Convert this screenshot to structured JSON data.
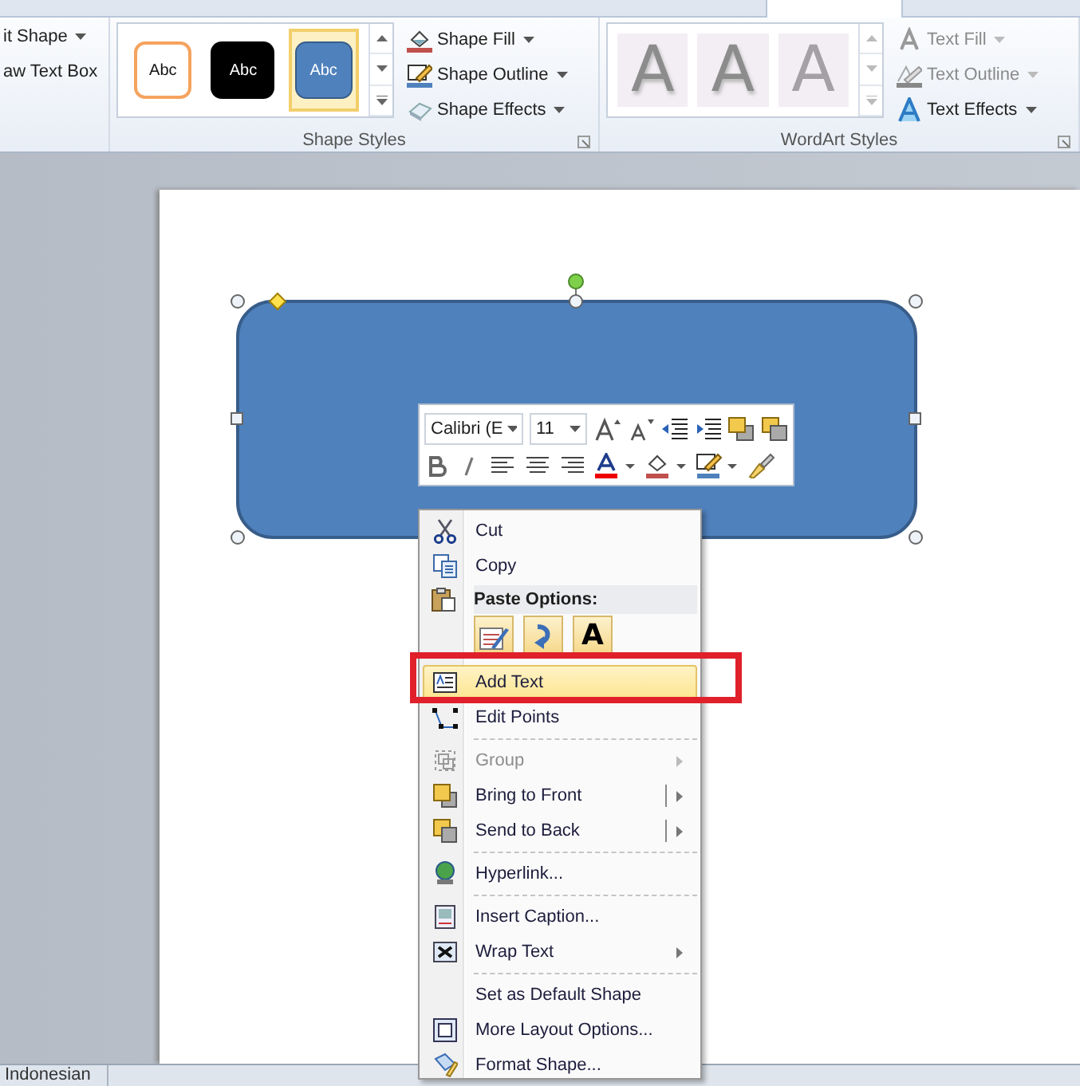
{
  "ribbon": {
    "partial_group": {
      "buttons": [
        {
          "label": "it Shape",
          "dropdown": true
        },
        {
          "label": "aw Text Box"
        }
      ]
    },
    "shape_styles": {
      "swatches": [
        {
          "label": "Abc",
          "kind": "outline",
          "selected": false
        },
        {
          "label": "Abc",
          "kind": "dark",
          "selected": false
        },
        {
          "label": "Abc",
          "kind": "blue",
          "selected": true
        }
      ],
      "buttons": [
        {
          "label": "Shape Fill",
          "disabled": false
        },
        {
          "label": "Shape Outline",
          "disabled": false
        },
        {
          "label": "Shape Effects",
          "disabled": false
        }
      ],
      "title": "Shape Styles"
    },
    "wordart_styles": {
      "swatches": [
        {
          "label": "A",
          "kind": "shadow"
        },
        {
          "label": "A",
          "kind": "shadow"
        },
        {
          "label": "A",
          "kind": "faint"
        }
      ],
      "buttons": [
        {
          "label": "Text Fill",
          "disabled": true
        },
        {
          "label": "Text Outline",
          "disabled": true
        },
        {
          "label": "Text Effects",
          "disabled": false
        }
      ],
      "title": "WordArt Styles"
    }
  },
  "mini_toolbar": {
    "font": "Calibri (E",
    "size": "11"
  },
  "context_menu": {
    "items": [
      {
        "kind": "item",
        "label": "Cut",
        "disabled": false,
        "submenu": false,
        "split": false,
        "selected": false,
        "annotated": false
      },
      {
        "kind": "item",
        "label": "Copy",
        "disabled": false,
        "submenu": false,
        "split": false,
        "selected": false,
        "annotated": false
      },
      {
        "kind": "header",
        "label": "Paste Options:"
      },
      {
        "kind": "paste",
        "buttons": [
          {
            "kind": "icon"
          },
          {
            "kind": "icon"
          },
          {
            "kind": "text",
            "label": "A"
          }
        ]
      },
      {
        "kind": "item",
        "label": "Add Text",
        "disabled": false,
        "submenu": false,
        "split": false,
        "selected": true,
        "annotated": true
      },
      {
        "kind": "item",
        "label": "Edit Points",
        "disabled": false,
        "submenu": false,
        "split": false,
        "selected": false,
        "annotated": false
      },
      {
        "kind": "separator"
      },
      {
        "kind": "item",
        "label": "Group",
        "disabled": true,
        "submenu": true,
        "split": false,
        "selected": false,
        "annotated": false
      },
      {
        "kind": "item",
        "label": "Bring to Front",
        "disabled": false,
        "submenu": true,
        "split": true,
        "selected": false,
        "annotated": false
      },
      {
        "kind": "item",
        "label": "Send to Back",
        "disabled": false,
        "submenu": true,
        "split": true,
        "selected": false,
        "annotated": false
      },
      {
        "kind": "separator"
      },
      {
        "kind": "item",
        "label": "Hyperlink...",
        "disabled": false,
        "submenu": false,
        "split": false,
        "selected": false,
        "annotated": false
      },
      {
        "kind": "separator"
      },
      {
        "kind": "item",
        "label": "Insert Caption...",
        "disabled": false,
        "submenu": false,
        "split": false,
        "selected": false,
        "annotated": false
      },
      {
        "kind": "item",
        "label": "Wrap Text",
        "disabled": false,
        "submenu": true,
        "split": false,
        "selected": false,
        "annotated": false
      },
      {
        "kind": "separator"
      },
      {
        "kind": "item",
        "label": "Set as Default Shape",
        "disabled": false,
        "submenu": false,
        "split": false,
        "selected": false,
        "annotated": false
      },
      {
        "kind": "item",
        "label": "More Layout Options...",
        "disabled": false,
        "submenu": false,
        "split": false,
        "selected": false,
        "annotated": false
      },
      {
        "kind": "item",
        "label": "Format Shape...",
        "disabled": false,
        "submenu": false,
        "split": false,
        "selected": false,
        "annotated": false
      }
    ]
  },
  "status_bar": {
    "language": "Indonesian"
  }
}
